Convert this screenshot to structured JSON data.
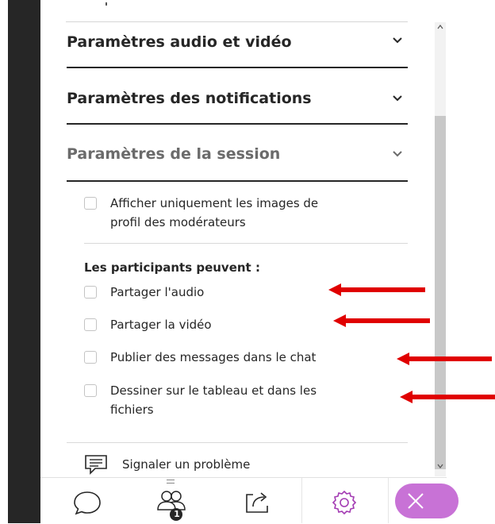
{
  "sections": [
    {
      "title": "Paramètres audio et vidéo",
      "state": "collapsed"
    },
    {
      "title": "Paramètres des notifications",
      "state": "collapsed"
    },
    {
      "title": "Paramètres de la session",
      "state": "expanded"
    }
  ],
  "session": {
    "moderator_option": {
      "line1": "Afficher uniquement les images de",
      "line2": "profil des modérateurs",
      "checked": false
    },
    "participants_label": "Les participants peuvent :",
    "options": [
      {
        "label": "Partager l'audio",
        "checked": false
      },
      {
        "label": "Partager la vidéo",
        "checked": false
      },
      {
        "label": "Publier des messages dans le chat",
        "checked": false
      },
      {
        "line1": "Dessiner sur le tableau et dans les",
        "line2": "fichiers",
        "checked": false
      }
    ]
  },
  "report_problem": "Signaler un problème",
  "bottom_nav": {
    "items": [
      "chat-icon",
      "participants-icon",
      "share-icon",
      "settings-icon",
      "close-icon"
    ],
    "participants_badge": "1",
    "active": "settings-icon"
  },
  "colors": {
    "text": "#262626",
    "muted": "#6b6b6b",
    "accent_purple": "#c872d6",
    "annotation_arrow": "#e00000",
    "sidebar_dark": "#262626"
  }
}
